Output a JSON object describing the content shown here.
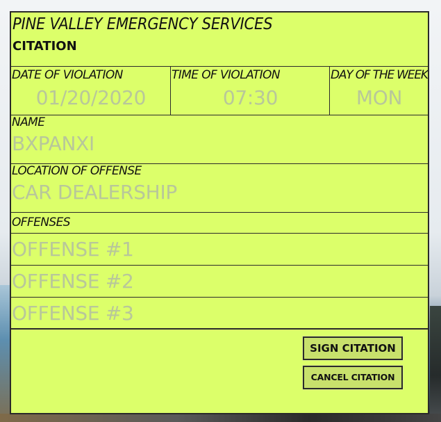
{
  "form": {
    "agency": "PINE VALLEY EMERGENCY SERVICES",
    "title": "CITATION",
    "fields": {
      "date": {
        "label": "DATE OF VIOLATION",
        "value": "01/20/2020"
      },
      "time": {
        "label": "TIME OF VIOLATION",
        "value": "07:30"
      },
      "day": {
        "label": "DAY OF THE WEEK",
        "value": "MON"
      },
      "name": {
        "label": "NAME",
        "value": "BXPANXI"
      },
      "location": {
        "label": "LOCATION OF OFFENSE",
        "value": "CAR DEALERSHIP"
      }
    },
    "offenses": {
      "label": "OFFENSES",
      "items": [
        "OFFENSE #1",
        "OFFENSE #2",
        "OFFENSE #3"
      ]
    },
    "buttons": {
      "sign": "SIGN CITATION",
      "cancel": "CANCEL CITATION"
    },
    "colors": {
      "panel": "#dcff6a",
      "value_text": "#b8c79a",
      "button": "#c8e16c",
      "border": "#2a2a2a"
    }
  }
}
